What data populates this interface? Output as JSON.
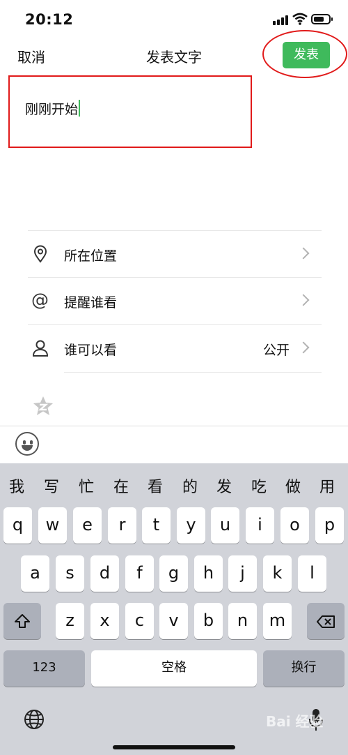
{
  "status": {
    "time": "20:12"
  },
  "nav": {
    "cancel": "取消",
    "title": "发表文字",
    "post": "发表"
  },
  "compose": {
    "text": "刚刚开始"
  },
  "options": [
    {
      "label": "所在位置",
      "value": ""
    },
    {
      "label": "提醒谁看",
      "value": ""
    },
    {
      "label": "谁可以看",
      "value": "公开"
    }
  ],
  "keyboard": {
    "candidates": [
      "我",
      "写",
      "忙",
      "在",
      "看",
      "的",
      "发",
      "吃",
      "做",
      "用"
    ],
    "row1": [
      "q",
      "w",
      "e",
      "r",
      "t",
      "y",
      "u",
      "i",
      "o",
      "p"
    ],
    "row2": [
      "a",
      "s",
      "d",
      "f",
      "g",
      "h",
      "j",
      "k",
      "l"
    ],
    "row3": [
      "z",
      "x",
      "c",
      "v",
      "b",
      "n",
      "m"
    ],
    "numbers": "123",
    "space": "空格",
    "return": "换行"
  },
  "watermark": "Bai 经验"
}
